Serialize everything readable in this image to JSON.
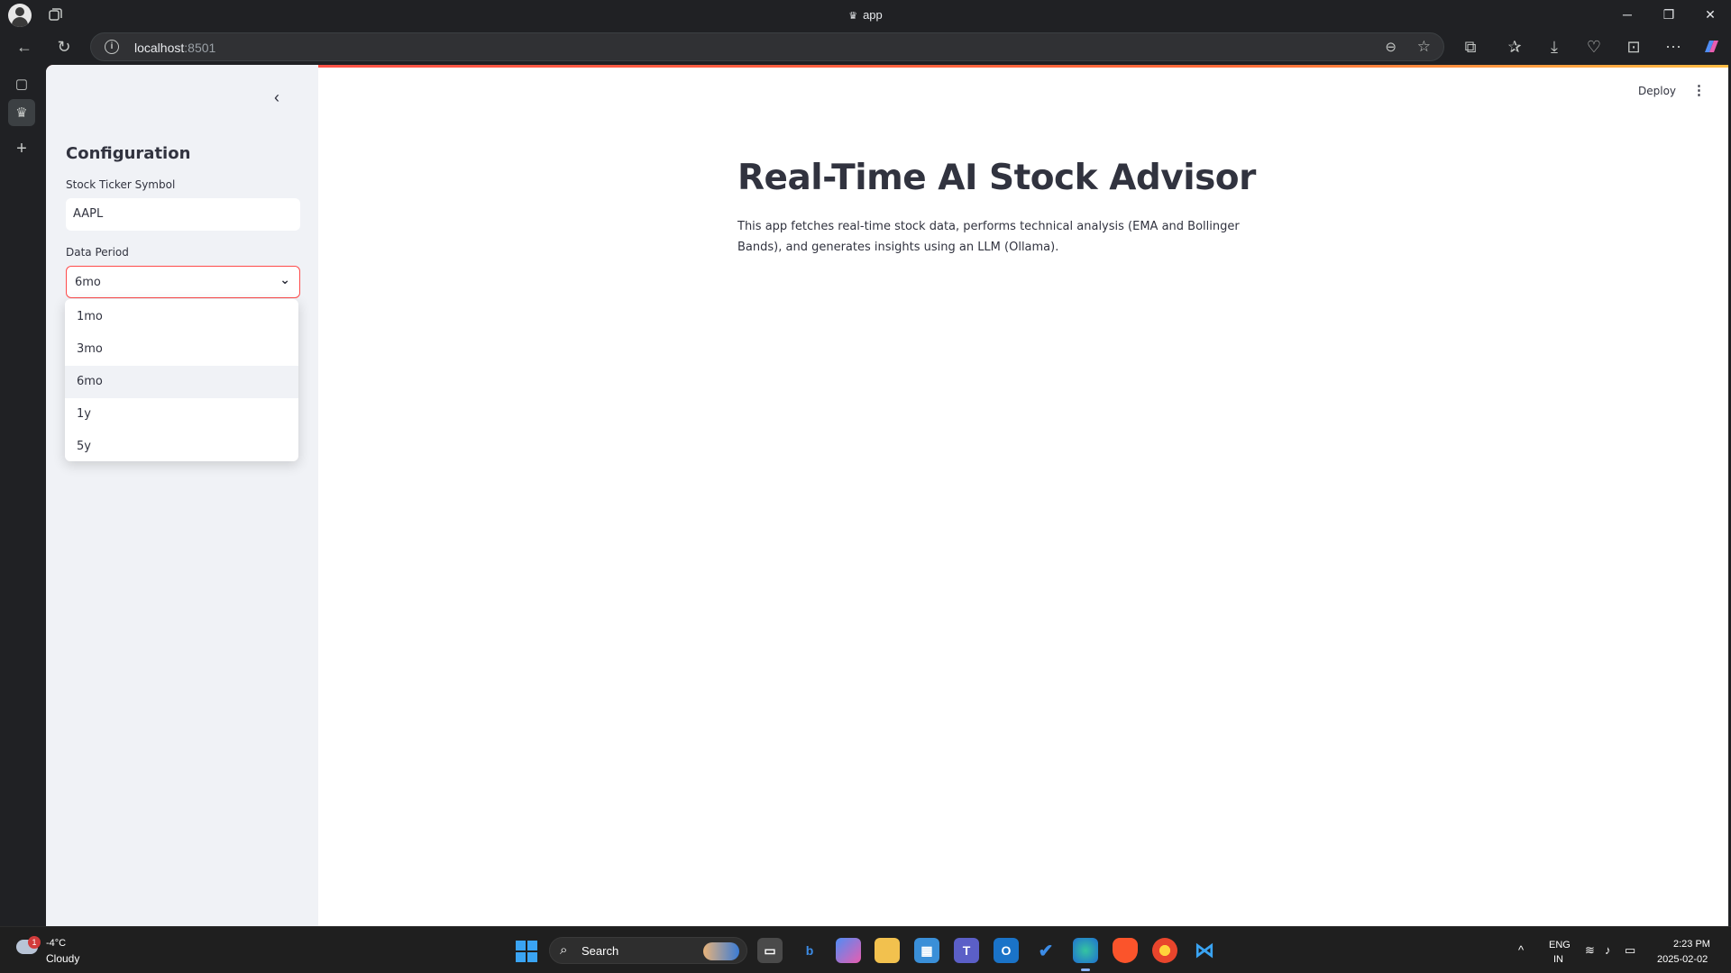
{
  "browser": {
    "tab_title": "app",
    "url_host": "localhost",
    "url_port": ":8501"
  },
  "sidebar": {
    "title": "Configuration",
    "ticker_label": "Stock Ticker Symbol",
    "ticker_value": "AAPL",
    "period_label": "Data Period",
    "period_selected": "6mo",
    "period_options": [
      "1mo",
      "3mo",
      "6mo",
      "1y",
      "5y"
    ]
  },
  "header": {
    "deploy_label": "Deploy"
  },
  "main": {
    "title": "Real-Time AI Stock Advisor",
    "description": "This app fetches real-time stock data, performs technical analysis (EMA and Bollinger Bands), and generates insights using an LLM (Ollama)."
  },
  "taskbar": {
    "weather_temp": "-4°C",
    "weather_condition": "Cloudy",
    "weather_badge": "1",
    "search_label": "Search",
    "lang_primary": "ENG",
    "lang_secondary": "IN",
    "time": "2:23 PM",
    "date": "2025-02-02"
  },
  "colors": {
    "accent": "#ff4b4b",
    "sidebar_bg": "#f0f2f6",
    "text": "#31333f"
  }
}
